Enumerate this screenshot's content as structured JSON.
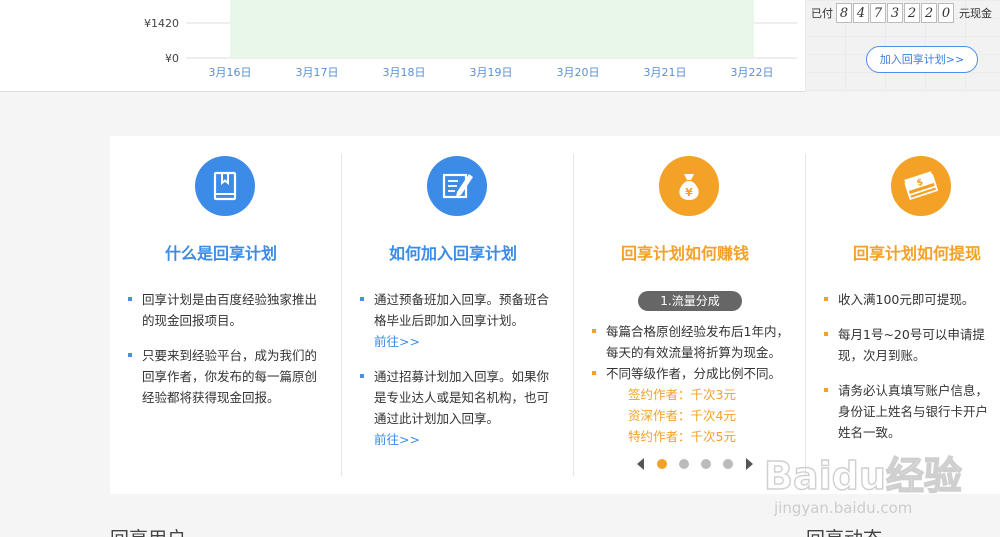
{
  "chart": {
    "y_tick_labels": [
      "¥1420",
      "¥0"
    ],
    "x_tick_labels": [
      "3月16日",
      "3月17日",
      "3月18日",
      "3月19日",
      "3月20日",
      "3月21日",
      "3月22日"
    ],
    "colors": {
      "fill": "#e9f6ea",
      "axis_text": "#5b8fd4",
      "grid": "#dddddd"
    }
  },
  "payout": {
    "prefix": "已付",
    "digits": [
      "8",
      "4",
      "7",
      "3",
      "2",
      "2",
      "0"
    ],
    "suffix": "元现金",
    "join_button": "加入回享计划>>"
  },
  "columns": [
    {
      "icon": "book-icon",
      "title": "什么是回享计划",
      "items": [
        {
          "text": "回享计划是由百度经验独家推出的现金回报项目。"
        },
        {
          "text": "只要来到经验平台，成为我们的回享作者，你发布的每一篇原创经验都将获得现金回报。"
        }
      ]
    },
    {
      "icon": "edit-document-icon",
      "title": "如何加入回享计划",
      "items": [
        {
          "text": "通过预备班加入回享。预备班合格毕业后即加入回享计划。",
          "link": "前往>>"
        },
        {
          "text": "通过招募计划加入回享。如果你是专业达人或是知名机构，也可通过此计划加入回享。",
          "link": "前往>>"
        }
      ]
    },
    {
      "icon": "money-bag-icon",
      "title": "回享计划如何赚钱",
      "pill": "1.流量分成",
      "items": [
        {
          "text": "每篇合格原创经验发布后1年内，每天的有效流量将折算为现金。"
        },
        {
          "text": "不同等级作者，分成比例不同。"
        }
      ],
      "sub_items": [
        "签约作者：千次3元",
        "资深作者：千次4元",
        "特约作者：千次5元"
      ]
    },
    {
      "icon": "cash-stack-icon",
      "title": "回享计划如何提现",
      "items": [
        {
          "text": "收入满100元即可提现。"
        },
        {
          "text": "每月1号~20号可以申请提现，次月到账。"
        },
        {
          "text": "请务必认真填写账户信息，身份证上姓名与银行卡开户姓名一致。"
        }
      ]
    }
  ],
  "carousel": {
    "dots": 4,
    "active_index": 0
  },
  "bottom_headings": [
    "回享用户",
    "回享动态"
  ],
  "watermark": {
    "brand": "Baidu经验",
    "url": "jingyan.baidu.com"
  },
  "colors": {
    "blue": "#3c8be6",
    "orange": "#f4a127"
  }
}
